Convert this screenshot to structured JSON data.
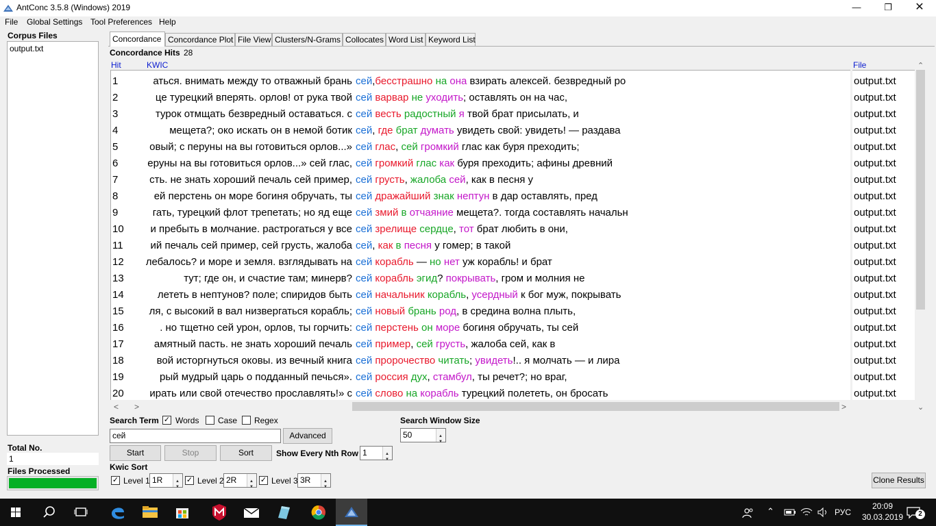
{
  "window": {
    "title": "AntConc 3.5.8 (Windows) 2019"
  },
  "menu": [
    "File",
    "Global Settings",
    "Tool Preferences",
    "Help"
  ],
  "corpus": {
    "label": "Corpus Files",
    "files": [
      "output.txt"
    ],
    "total_label": "Total No.",
    "total_value": "1",
    "processed_label": "Files Processed",
    "progress": 1.0
  },
  "tabs": [
    "Concordance",
    "Concordance Plot",
    "File View",
    "Clusters/N-Grams",
    "Collocates",
    "Word List",
    "Keyword List"
  ],
  "hits": {
    "label": "Concordance Hits",
    "count": "28"
  },
  "columns": {
    "hit": "Hit",
    "kwic": "KWIC",
    "file": "File"
  },
  "rows": [
    {
      "n": "1",
      "left": "аться. внимать между то отважный брань ",
      "kw": "сей",
      ",": "",
      "p": [
        [
          ",",
          ""
        ],
        [
          "бесстрашно",
          "r1"
        ],
        [
          " ",
          ""
        ],
        [
          "на",
          "r2"
        ],
        [
          " ",
          ""
        ],
        [
          "она",
          "r3"
        ],
        [
          " взирать алексей. безвредный ро",
          ""
        ]
      ],
      "file": "output.txt"
    },
    {
      "n": "2",
      "left": "це турецкий вперять. орлов! от рука твой ",
      "kw": "сей",
      "p": [
        [
          " ",
          ""
        ],
        [
          "варвар",
          "r1"
        ],
        [
          " ",
          ""
        ],
        [
          "не",
          "r2"
        ],
        [
          " ",
          ""
        ],
        [
          "уходить",
          "r3"
        ],
        [
          "; оставлять он на час,",
          ""
        ]
      ],
      "file": "output.txt"
    },
    {
      "n": "3",
      "left": "турок отмщать безвредный оставаться. с ",
      "kw": "сей",
      "p": [
        [
          " ",
          ""
        ],
        [
          "весть",
          "r1"
        ],
        [
          " ",
          ""
        ],
        [
          "радостный",
          "r2"
        ],
        [
          " ",
          ""
        ],
        [
          "я",
          "r3"
        ],
        [
          " твой брат присылать, и",
          ""
        ]
      ],
      "file": "output.txt"
    },
    {
      "n": "4",
      "left": "мещета?;  око искать он в немой ботик ",
      "kw": "сей",
      "p": [
        [
          ", ",
          ""
        ],
        [
          "где",
          "r1"
        ],
        [
          " ",
          ""
        ],
        [
          "брат",
          "r2"
        ],
        [
          " ",
          ""
        ],
        [
          "думать",
          "r3"
        ],
        [
          " увидеть свой: увидеть! — раздава",
          ""
        ]
      ],
      "file": "output.txt"
    },
    {
      "n": "5",
      "left": "овый; с перуны на вы готовиться орлов...» ",
      "kw": "сей",
      "p": [
        [
          " ",
          ""
        ],
        [
          "глас",
          "r1"
        ],
        [
          ", ",
          ""
        ],
        [
          "сей",
          "r2"
        ],
        [
          " ",
          ""
        ],
        [
          "громкий",
          "r3"
        ],
        [
          " глас как буря преходить;",
          ""
        ]
      ],
      "file": "output.txt"
    },
    {
      "n": "6",
      "left": "еруны на вы готовиться орлов...»  сей глас, ",
      "kw": "сей",
      "p": [
        [
          " ",
          ""
        ],
        [
          "громкий",
          "r1"
        ],
        [
          " ",
          ""
        ],
        [
          "глас",
          "r2"
        ],
        [
          " ",
          ""
        ],
        [
          "как",
          "r3"
        ],
        [
          " буря преходить; афины древний",
          ""
        ]
      ],
      "file": "output.txt"
    },
    {
      "n": "7",
      "left": "сть. не знать хороший печаль сей пример, ",
      "kw": "сей",
      "p": [
        [
          " ",
          ""
        ],
        [
          "грусть",
          "r1"
        ],
        [
          ", ",
          ""
        ],
        [
          "жалоба",
          "r2"
        ],
        [
          " ",
          ""
        ],
        [
          "сей",
          "r3"
        ],
        [
          ", как в песня у",
          ""
        ]
      ],
      "file": "output.txt"
    },
    {
      "n": "8",
      "left": "ей перстень он море богиня обручать, ты ",
      "kw": "сей",
      "p": [
        [
          " ",
          ""
        ],
        [
          "дражайший",
          "r1"
        ],
        [
          " ",
          ""
        ],
        [
          "знак",
          "r2"
        ],
        [
          " ",
          ""
        ],
        [
          "нептун",
          "r3"
        ],
        [
          " в дар оставлять, пред",
          ""
        ]
      ],
      "file": "output.txt"
    },
    {
      "n": "9",
      "left": "гать, турецкий флот трепетать; но яд еще ",
      "kw": "сей",
      "p": [
        [
          " ",
          ""
        ],
        [
          "змий",
          "r1"
        ],
        [
          " ",
          ""
        ],
        [
          "в",
          "r2"
        ],
        [
          " ",
          ""
        ],
        [
          "отчаяние",
          "r3"
        ],
        [
          " мещета?. тогда составлять начальн",
          ""
        ]
      ],
      "file": "output.txt"
    },
    {
      "n": "10",
      "left": "и пребыть в молчание. растрогаться у все ",
      "kw": "сей",
      "p": [
        [
          " ",
          ""
        ],
        [
          "зрелище",
          "r1"
        ],
        [
          " ",
          ""
        ],
        [
          "сердце",
          "r2"
        ],
        [
          ", ",
          ""
        ],
        [
          "тот",
          "r3"
        ],
        [
          " брат любить в они,",
          ""
        ]
      ],
      "file": "output.txt"
    },
    {
      "n": "11",
      "left": "ий печаль сей пример, сей грусть, жалоба ",
      "kw": "сей",
      "p": [
        [
          ", ",
          ""
        ],
        [
          "как",
          "r1"
        ],
        [
          " ",
          ""
        ],
        [
          "в",
          "r2"
        ],
        [
          " ",
          ""
        ],
        [
          "песня",
          "r3"
        ],
        [
          " у гомер; в такой",
          ""
        ]
      ],
      "file": "output.txt"
    },
    {
      "n": "12",
      "left": "лебалось? и море и земля. взглядывать на ",
      "kw": "сей",
      "p": [
        [
          " ",
          ""
        ],
        [
          "корабль",
          "r1"
        ],
        [
          " — ",
          ""
        ],
        [
          "но",
          "r2"
        ],
        [
          " ",
          ""
        ],
        [
          "нет",
          "r3"
        ],
        [
          " уж корабль! и брат",
          ""
        ]
      ],
      "file": "output.txt"
    },
    {
      "n": "13",
      "left": "тут; где он, и счастие там; минерв? ",
      "kw": "сей",
      "p": [
        [
          " ",
          ""
        ],
        [
          "корабль",
          "r1"
        ],
        [
          " ",
          ""
        ],
        [
          "эгид",
          "r2"
        ],
        [
          "? ",
          ""
        ],
        [
          "покрывать",
          "r3"
        ],
        [
          ", гром и молния не",
          ""
        ]
      ],
      "file": "output.txt"
    },
    {
      "n": "14",
      "left": " лететь в нептунов? поле;  спиридов быть ",
      "kw": "сей",
      "p": [
        [
          " ",
          ""
        ],
        [
          "начальник",
          "r1"
        ],
        [
          " ",
          ""
        ],
        [
          "корабль",
          "r2"
        ],
        [
          ", ",
          ""
        ],
        [
          "усердный",
          "r3"
        ],
        [
          " к бог муж, покрывать",
          ""
        ]
      ],
      "file": "output.txt"
    },
    {
      "n": "15",
      "left": "ля, с высокий в вал низвергаться корабль; ",
      "kw": "сей",
      "p": [
        [
          " ",
          ""
        ],
        [
          "новый",
          "r1"
        ],
        [
          " ",
          ""
        ],
        [
          "брань",
          "r2"
        ],
        [
          " ",
          ""
        ],
        [
          "род",
          "r3"
        ],
        [
          ", в средина волна плыть,",
          ""
        ]
      ],
      "file": "output.txt"
    },
    {
      "n": "16",
      "left": ". но тщетно сей урон, орлов, ты горчить: ",
      "kw": "сей",
      "p": [
        [
          " ",
          ""
        ],
        [
          "перстень",
          "r1"
        ],
        [
          " ",
          ""
        ],
        [
          "он",
          "r2"
        ],
        [
          " ",
          ""
        ],
        [
          "море",
          "r3"
        ],
        [
          " богиня обручать, ты сей",
          ""
        ]
      ],
      "file": "output.txt"
    },
    {
      "n": "17",
      "left": "амятный пасть. не знать хороший печаль ",
      "kw": "сей",
      "p": [
        [
          " ",
          ""
        ],
        [
          "пример",
          "r1"
        ],
        [
          ", ",
          ""
        ],
        [
          "сей",
          "r2"
        ],
        [
          " ",
          ""
        ],
        [
          "грусть",
          "r3"
        ],
        [
          ", жалоба сей, как в",
          ""
        ]
      ],
      "file": "output.txt"
    },
    {
      "n": "18",
      "left": "вой исторгнуться оковы. из вечный книга ",
      "kw": "сей",
      "p": [
        [
          " ",
          ""
        ],
        [
          "пророчество",
          "r1"
        ],
        [
          " ",
          ""
        ],
        [
          "читать",
          "r2"
        ],
        [
          "; ",
          ""
        ],
        [
          "увидеть",
          "r3"
        ],
        [
          "!.. я молчать — и лира",
          ""
        ]
      ],
      "file": "output.txt"
    },
    {
      "n": "19",
      "left": "рый мудрый царь о подданный печься». ",
      "kw": "сей",
      "p": [
        [
          " ",
          ""
        ],
        [
          "россия",
          "r1"
        ],
        [
          " ",
          ""
        ],
        [
          "дух",
          "r2"
        ],
        [
          ", ",
          ""
        ],
        [
          "стамбул",
          "r3"
        ],
        [
          ", ты речет?; но враг,",
          ""
        ]
      ],
      "file": "output.txt"
    },
    {
      "n": "20",
      "left": "ирать или свой отечество прославлять!» с ",
      "kw": "сей",
      "p": [
        [
          " ",
          ""
        ],
        [
          "слово",
          "r1"
        ],
        [
          " ",
          ""
        ],
        [
          "на",
          "r2"
        ],
        [
          " ",
          ""
        ],
        [
          "корабль",
          "r3"
        ],
        [
          " турецкий полететь, он бросать",
          ""
        ]
      ],
      "file": "output.txt"
    }
  ],
  "search": {
    "label": "Search Term",
    "words_label": "Words",
    "case_label": "Case",
    "regex_label": "Regex",
    "value": "сей",
    "advanced_label": "Advanced"
  },
  "window_size": {
    "label": "Search Window Size",
    "value": "50"
  },
  "buttons": {
    "start": "Start",
    "stop": "Stop",
    "sort": "Sort",
    "clone": "Clone Results"
  },
  "nth_row": {
    "label": "Show Every Nth Row",
    "value": "1"
  },
  "kwic_sort": {
    "label": "Kwic Sort",
    "levels": [
      {
        "label": "Level 1",
        "value": "1R"
      },
      {
        "label": "Level 2",
        "value": "2R"
      },
      {
        "label": "Level 3",
        "value": "3R"
      }
    ]
  },
  "taskbar": {
    "lang": "РУС",
    "time": "20:09",
    "date": "30.03.2019",
    "notifications": "2"
  },
  "colors": {
    "kw": "#1a6fd6",
    "r1": "#e8192c",
    "r2": "#17a626",
    "r3": "#c317c9",
    "progress": "#06b025"
  }
}
